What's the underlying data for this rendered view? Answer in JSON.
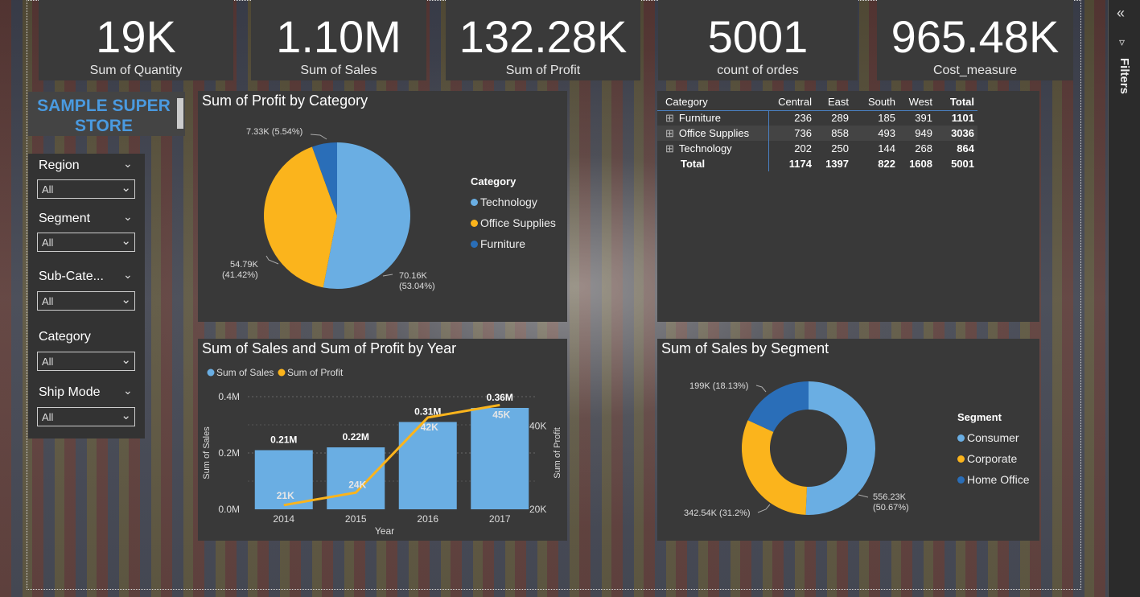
{
  "kpis": [
    {
      "value": "19K",
      "label": "Sum of Quantity"
    },
    {
      "value": "1.10M",
      "label": "Sum of Sales"
    },
    {
      "value": "132.28K",
      "label": "Sum of Profit"
    },
    {
      "value": "5001",
      "label": "count of ordes"
    },
    {
      "value": "965.48K",
      "label": "Cost_measure"
    }
  ],
  "logo": {
    "text": "SAMPLE SUPER STORE"
  },
  "slicers": [
    {
      "label": "Region",
      "value": "All"
    },
    {
      "label": "Segment",
      "value": "All"
    },
    {
      "label": "Sub-Cate...",
      "value": "All"
    },
    {
      "label": "Category",
      "value": "All"
    },
    {
      "label": "Ship Mode",
      "value": "All"
    }
  ],
  "pie": {
    "title": "Sum of Profit by Category",
    "legend_title": "Category",
    "labels": {
      "technology": "70.16K\n(53.04%)",
      "office": "54.79K\n(41.42%)",
      "furniture": "7.33K (5.54%)"
    }
  },
  "matrix": {
    "headers": [
      "Category",
      "Central",
      "East",
      "South",
      "West",
      "Total"
    ],
    "rows": [
      {
        "name": "Furniture",
        "values": [
          "236",
          "289",
          "185",
          "391",
          "1101"
        ]
      },
      {
        "name": "Office Supplies",
        "values": [
          "736",
          "858",
          "493",
          "949",
          "3036"
        ]
      },
      {
        "name": "Technology",
        "values": [
          "202",
          "250",
          "144",
          "268",
          "864"
        ]
      }
    ],
    "total": {
      "name": "Total",
      "values": [
        "1174",
        "1397",
        "822",
        "1608",
        "5001"
      ]
    },
    "expand_icon": "plus-box-icon"
  },
  "combo": {
    "title": "Sum of Sales and Sum of Profit by Year"
  },
  "donut": {
    "title": "Sum of Sales by Segment",
    "legend_title": "Segment"
  },
  "filters_pane": {
    "label": "Filters",
    "collapse_icon": "double-chevron-left-icon",
    "filter_icon": "funnel-icon"
  },
  "colors": {
    "light_blue": "#6aaee3",
    "yellow": "#fbb41c",
    "dark_blue": "#2a6eb8",
    "card": "#393939"
  },
  "chart_data": [
    {
      "type": "pie",
      "title": "Sum of Profit by Category",
      "legend_title": "Category",
      "categories": [
        "Technology",
        "Office Supplies",
        "Furniture"
      ],
      "values": [
        70160,
        54790,
        7330
      ],
      "percents": [
        53.04,
        41.42,
        5.54
      ],
      "legend_placement": "right"
    },
    {
      "type": "bar",
      "title": "Sum of Sales and Sum of Profit by Year",
      "xlabel": "Year",
      "ylabel": "Sum of Sales",
      "y2label": "Sum of Profit",
      "categories": [
        "2014",
        "2015",
        "2016",
        "2017"
      ],
      "series": [
        {
          "name": "Sum of Sales",
          "type": "bar",
          "values": [
            0.21,
            0.22,
            0.31,
            0.36
          ],
          "labels": [
            "0.21M",
            "0.22M",
            "0.31M",
            "0.36M"
          ]
        },
        {
          "name": "Sum of Profit",
          "type": "line",
          "values": [
            21,
            24,
            42,
            45
          ],
          "labels": [
            "21K",
            "24K",
            "42K",
            "45K"
          ]
        }
      ],
      "yticks": [
        "0.0M",
        "0.2M",
        "0.4M"
      ],
      "ylim": [
        0,
        0.4
      ],
      "y2ticks": [
        "20K",
        "40K"
      ],
      "y2lim": [
        20,
        47
      ],
      "legend_placement": "top-left"
    },
    {
      "type": "pie",
      "subtype": "donut",
      "title": "Sum of Sales by Segment",
      "legend_title": "Segment",
      "categories": [
        "Consumer",
        "Corporate",
        "Home Office"
      ],
      "values": [
        556230,
        342540,
        199000
      ],
      "labels": [
        "556.23K\n(50.67%)",
        "342.54K (31.2%)",
        "199K (18.13%)"
      ],
      "percents": [
        50.67,
        31.2,
        18.13
      ],
      "legend_placement": "right"
    }
  ]
}
